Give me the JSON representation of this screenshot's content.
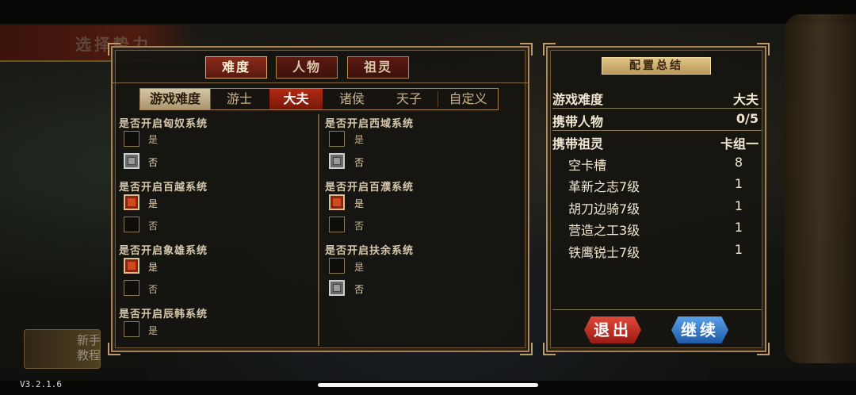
{
  "header": {
    "title": "选择势力"
  },
  "tutorial": {
    "label": "新手教程"
  },
  "version": "V3.2.1.6",
  "tabs": [
    {
      "label": "难度",
      "active": true
    },
    {
      "label": "人物",
      "active": false
    },
    {
      "label": "祖灵",
      "active": false
    }
  ],
  "difficulty": {
    "label": "游戏难度",
    "options": [
      "游士",
      "大夫",
      "诸侯",
      "天子",
      "自定义"
    ],
    "selected": "大夫"
  },
  "options": {
    "left": [
      {
        "title": "是否开启匈奴系统",
        "yes": "是",
        "no": "否",
        "value": "否"
      },
      {
        "title": "是否开启百越系统",
        "yes": "是",
        "no": "否",
        "value": "是"
      },
      {
        "title": "是否开启象雄系统",
        "yes": "是",
        "no": "否",
        "value": "是"
      },
      {
        "title": "是否开启辰韩系统",
        "yes": "是",
        "no": "",
        "value": ""
      }
    ],
    "right": [
      {
        "title": "是否开启西域系统",
        "yes": "是",
        "no": "否",
        "value": "否"
      },
      {
        "title": "是否开启百濮系统",
        "yes": "是",
        "no": "否",
        "value": "是"
      },
      {
        "title": "是否开启扶余系统",
        "yes": "是",
        "no": "否",
        "value": "否"
      }
    ]
  },
  "summary": {
    "header": "配置总结",
    "rows": [
      {
        "key": "游戏难度",
        "value": "大夫"
      },
      {
        "key": "携带人物",
        "value": "0/5"
      },
      {
        "key": "携带祖灵",
        "value": "卡组一"
      }
    ],
    "sub_rows": [
      {
        "key": "空卡槽",
        "value": "8"
      },
      {
        "key": "革新之志7级",
        "value": "1"
      },
      {
        "key": "胡刀边骑7级",
        "value": "1"
      },
      {
        "key": "营造之工3级",
        "value": "1"
      },
      {
        "key": "铁鹰锐士7级",
        "value": "1"
      }
    ]
  },
  "buttons": {
    "exit": "退出",
    "continue": "继续"
  },
  "colors": {
    "accent_red": "#b02a14",
    "border_gold": "#a7835a",
    "continue_blue": "#1e5aa8"
  }
}
